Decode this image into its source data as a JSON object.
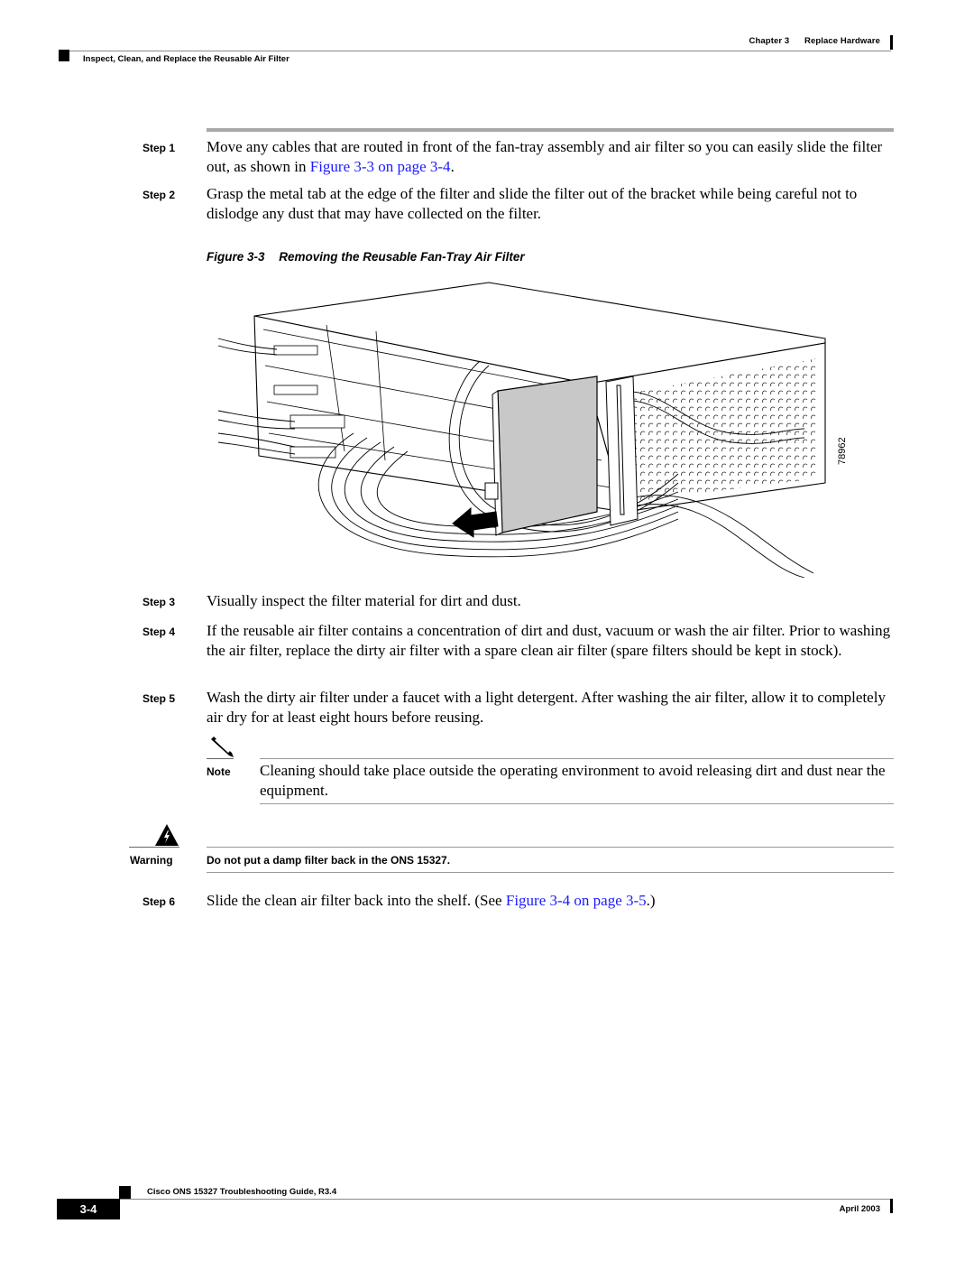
{
  "header": {
    "chapter_label": "Chapter 3",
    "chapter_title": "Replace Hardware",
    "section_title": "Inspect, Clean, and Replace the Reusable Air Filter"
  },
  "steps": [
    {
      "label": "Step 1",
      "text_before": "Move any cables that are routed in front of the fan-tray assembly and air filter so you can easily slide the filter out, as shown in ",
      "link_text": "Figure 3-3 on page 3-4",
      "text_after": "."
    },
    {
      "label": "Step 2",
      "text": "Grasp the metal tab at the edge of the filter and slide the filter out of the bracket while being careful not to dislodge any dust that may have collected on the filter."
    },
    {
      "label": "Step 3",
      "text": "Visually inspect the filter material for dirt and dust."
    },
    {
      "label": "Step 4",
      "text": "If the reusable air filter contains a concentration of dirt and dust, vacuum or wash the air filter. Prior to washing the air filter, replace the dirty air filter with a spare clean air filter (spare filters should be kept in stock)."
    },
    {
      "label": "Step 5",
      "text": "Wash the dirty air filter under a faucet with a light detergent. After washing the air filter, allow it to completely air dry for at least eight hours before reusing."
    },
    {
      "label": "Step 6",
      "text_before": "Slide the clean air filter back into the shelf. (See ",
      "link_text": "Figure 3-4 on page 3-5",
      "text_after": ".)"
    }
  ],
  "figure": {
    "number": "Figure 3-3",
    "caption": "Removing the Reusable Fan-Tray Air Filter",
    "art_id": "78962",
    "icon": "chassis-illustration"
  },
  "note": {
    "icon": "pencil-icon",
    "label": "Note",
    "text": "Cleaning should take place outside the operating environment to avoid releasing dirt and dust near the equipment."
  },
  "warning": {
    "icon": "warning-triangle-icon",
    "label": "Warning",
    "text": "Do not put a damp filter back in the ONS 15327."
  },
  "footer": {
    "guide_title": "Cisco ONS 15327 Troubleshooting Guide, R3.4",
    "page_number": "3-4",
    "date": "April 2003"
  },
  "colors": {
    "link": "#1a1aff",
    "rule": "#a8a8a8",
    "filter_fill": "#c8c8c8"
  }
}
